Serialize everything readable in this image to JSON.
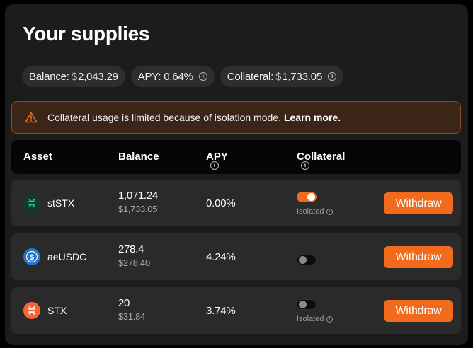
{
  "title": "Your supplies",
  "summary": {
    "balance_label": "Balance:",
    "balance_currency": "$",
    "balance_value": "2,043.29",
    "apy_label": "APY: 0.64%",
    "collateral_label": "Collateral:",
    "collateral_currency": "$",
    "collateral_value": "1,733.05"
  },
  "warning": {
    "text": "Collateral usage is limited because of isolation mode.",
    "link": "Learn more."
  },
  "table": {
    "headers": {
      "asset": "Asset",
      "balance": "Balance",
      "apy": "APY",
      "collateral": "Collateral"
    },
    "rows": [
      {
        "asset": "stSTX",
        "amount": "1,071.24",
        "usd": "$1,733.05",
        "apy": "0.00%",
        "collateral_on": true,
        "isolated": "Isolated",
        "action": "Withdraw",
        "icon": "ststx-icon",
        "icon_color": "#123a2a"
      },
      {
        "asset": "aeUSDC",
        "amount": "278.4",
        "usd": "$278.40",
        "apy": "4.24%",
        "collateral_on": false,
        "isolated": "",
        "action": "Withdraw",
        "icon": "usdc-icon",
        "icon_color": "#2775ca"
      },
      {
        "asset": "STX",
        "amount": "20",
        "usd": "$31.84",
        "apy": "3.74%",
        "collateral_on": false,
        "isolated": "Isolated",
        "action": "Withdraw",
        "icon": "stx-icon",
        "icon_color": "#fc6432"
      }
    ]
  },
  "colors": {
    "accent": "#f26a1b",
    "warning_bg": "#3b2418",
    "warning_border": "#8a4a24"
  }
}
